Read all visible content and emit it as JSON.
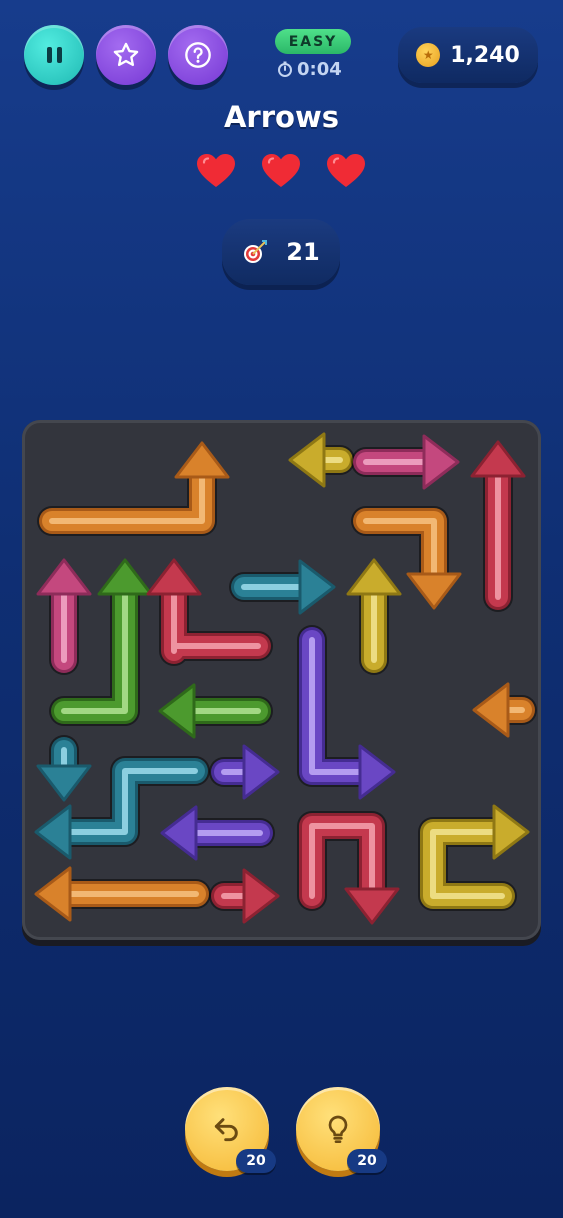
{
  "header": {
    "difficulty": "EASY",
    "timer": "0:04",
    "coins": "1,240"
  },
  "title": "Arrows",
  "lives": {
    "current": 3,
    "max": 3
  },
  "moves": "21",
  "controls": {
    "undo_count": "20",
    "hint_count": "20"
  },
  "icons": [
    "pause-icon",
    "star-icon",
    "help-icon",
    "stopwatch-icon",
    "coin-icon",
    "heart-icon",
    "target-icon",
    "undo-icon",
    "lightbulb-icon"
  ],
  "colors": {
    "orange": "#d9822b",
    "gold": "#c9ac2c",
    "pink": "#c4487e",
    "red": "#c4394e",
    "green": "#4c9a2e",
    "teal": "#2b8196",
    "purple": "#6a47c4",
    "easy_badge": "#3fce7a",
    "board": "#33353d",
    "background": "#12337a"
  },
  "board": {
    "grid": "8x8",
    "arrows": [
      {
        "color": "orange",
        "direction": "up"
      },
      {
        "color": "gold",
        "direction": "left"
      },
      {
        "color": "pink",
        "direction": "right"
      },
      {
        "color": "red",
        "direction": "up"
      },
      {
        "color": "orange",
        "direction": "down"
      },
      {
        "color": "pink",
        "direction": "up"
      },
      {
        "color": "green",
        "direction": "up"
      },
      {
        "color": "red",
        "direction": "up"
      },
      {
        "color": "teal",
        "direction": "right"
      },
      {
        "color": "gold",
        "direction": "up"
      },
      {
        "color": "purple",
        "direction": "right"
      },
      {
        "color": "green",
        "direction": "left"
      },
      {
        "color": "orange",
        "direction": "left"
      },
      {
        "color": "teal",
        "direction": "down"
      },
      {
        "color": "purple",
        "direction": "right"
      },
      {
        "color": "teal",
        "direction": "left"
      },
      {
        "color": "purple",
        "direction": "left"
      },
      {
        "color": "red",
        "direction": "down"
      },
      {
        "color": "gold",
        "direction": "right"
      },
      {
        "color": "orange",
        "direction": "left"
      },
      {
        "color": "red",
        "direction": "right"
      }
    ]
  }
}
